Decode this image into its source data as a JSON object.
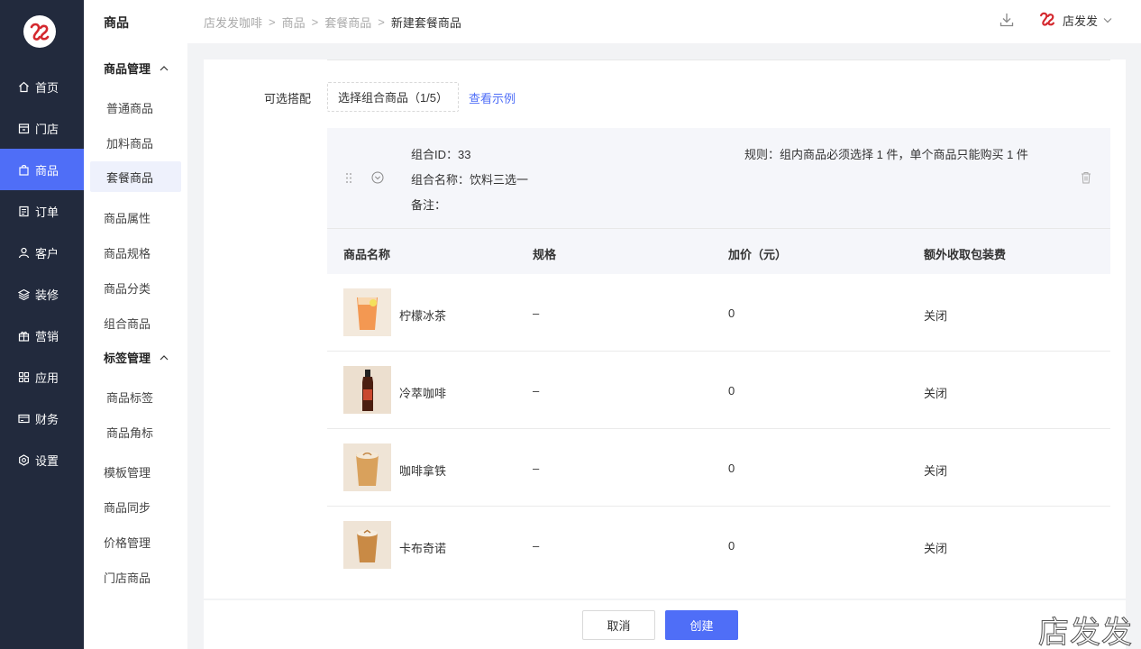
{
  "nav": {
    "items": [
      {
        "label": "首页",
        "icon": "home-icon"
      },
      {
        "label": "门店",
        "icon": "store-icon"
      },
      {
        "label": "商品",
        "icon": "bag-icon"
      },
      {
        "label": "订单",
        "icon": "order-icon"
      },
      {
        "label": "客户",
        "icon": "user-icon"
      },
      {
        "label": "装修",
        "icon": "layers-icon"
      },
      {
        "label": "营销",
        "icon": "gift-icon"
      },
      {
        "label": "应用",
        "icon": "apps-icon"
      },
      {
        "label": "财务",
        "icon": "card-icon"
      },
      {
        "label": "设置",
        "icon": "settings-icon"
      }
    ],
    "active_index": 2,
    "accent": "#4f6ef7",
    "bg": "#222a3d"
  },
  "subnav": {
    "title": "商品",
    "group1": "商品管理",
    "group1_items": [
      "普通商品",
      "加料商品",
      "套餐商品"
    ],
    "items_mid": [
      "商品属性",
      "商品规格",
      "商品分类",
      "组合商品"
    ],
    "group2": "标签管理",
    "group2_items": [
      "商品标签",
      "商品角标"
    ],
    "items_bottom": [
      "模板管理",
      "商品同步",
      "价格管理",
      "门店商品"
    ]
  },
  "header": {
    "breadcrumb": [
      "店发发咖啡",
      "商品",
      "套餐商品",
      "新建套餐商品"
    ],
    "user_name": "店发发"
  },
  "form": {
    "optional_label": "可选搭配",
    "select_button": "选择组合商品（1/5）",
    "example_link": "查看示例"
  },
  "combo": {
    "id_line": "组合ID：33",
    "name_line": "组合名称：饮料三选一",
    "note_line": "备注：",
    "rule": "规则：组内商品必须选择 1 件，单个商品只能购买 1 件"
  },
  "table": {
    "headers": [
      "商品名称",
      "规格",
      "加价（元）",
      "额外收取包装费"
    ],
    "rows": [
      {
        "name": "柠檬冰茶",
        "spec": "–",
        "price": "0",
        "fee": "关闭"
      },
      {
        "name": "冷萃咖啡",
        "spec": "–",
        "price": "0",
        "fee": "关闭"
      },
      {
        "name": "咖啡拿铁",
        "spec": "–",
        "price": "0",
        "fee": "关闭"
      },
      {
        "name": "卡布奇诺",
        "spec": "–",
        "price": "0",
        "fee": "关闭"
      }
    ]
  },
  "footer": {
    "cancel": "取消",
    "create": "创建"
  },
  "watermark": "店发发"
}
